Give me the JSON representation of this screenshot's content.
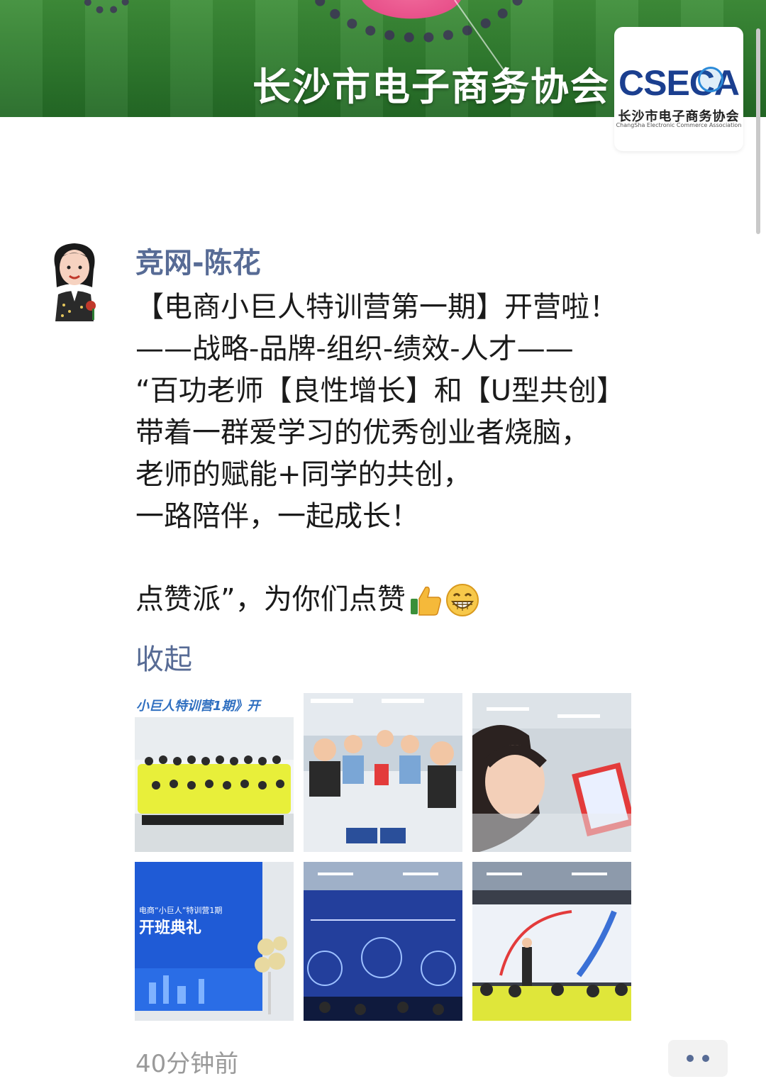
{
  "cover": {
    "title": "长沙市电子商务协会",
    "logo_text": "CSECA",
    "logo_cn": "长沙市电子商务协会",
    "logo_en": "ChangSha Electronic Commerce Association"
  },
  "post": {
    "author": "竞网-陈花",
    "lines": [
      "【电商小巨人特训营第一期】开营啦！",
      "——战略-品牌-组织-绩效-人才——",
      "“百功老师【良性增长】和【U型共创】",
      "带着一群爱学习的优秀创业者烧脑，",
      "老师的赋能+同学的共创，",
      "一路陪伴，一起成长！"
    ],
    "last_line": "点赞派”，为你们点赞",
    "emojis": [
      "thumbs-up-icon",
      "grin-emoji-icon"
    ],
    "collapse_label": "收起",
    "photos": [
      {
        "name": "photo-group-yellow-shirts",
        "caption": "小巨人特训营1期》开"
      },
      {
        "name": "photo-table-discussion",
        "caption": ""
      },
      {
        "name": "photo-selfie-with-sign",
        "caption": ""
      },
      {
        "name": "photo-opening-ceremony-board",
        "caption": "电商“小巨人”特训营1期",
        "caption2": "开班典礼"
      },
      {
        "name": "photo-presentation-screen",
        "caption": ""
      },
      {
        "name": "photo-speaker-on-stage",
        "caption": ""
      }
    ],
    "timestamp": "40分钟前"
  },
  "colors": {
    "link": "#576b95",
    "text": "#1a1a1a",
    "meta": "#9a9a9a"
  }
}
